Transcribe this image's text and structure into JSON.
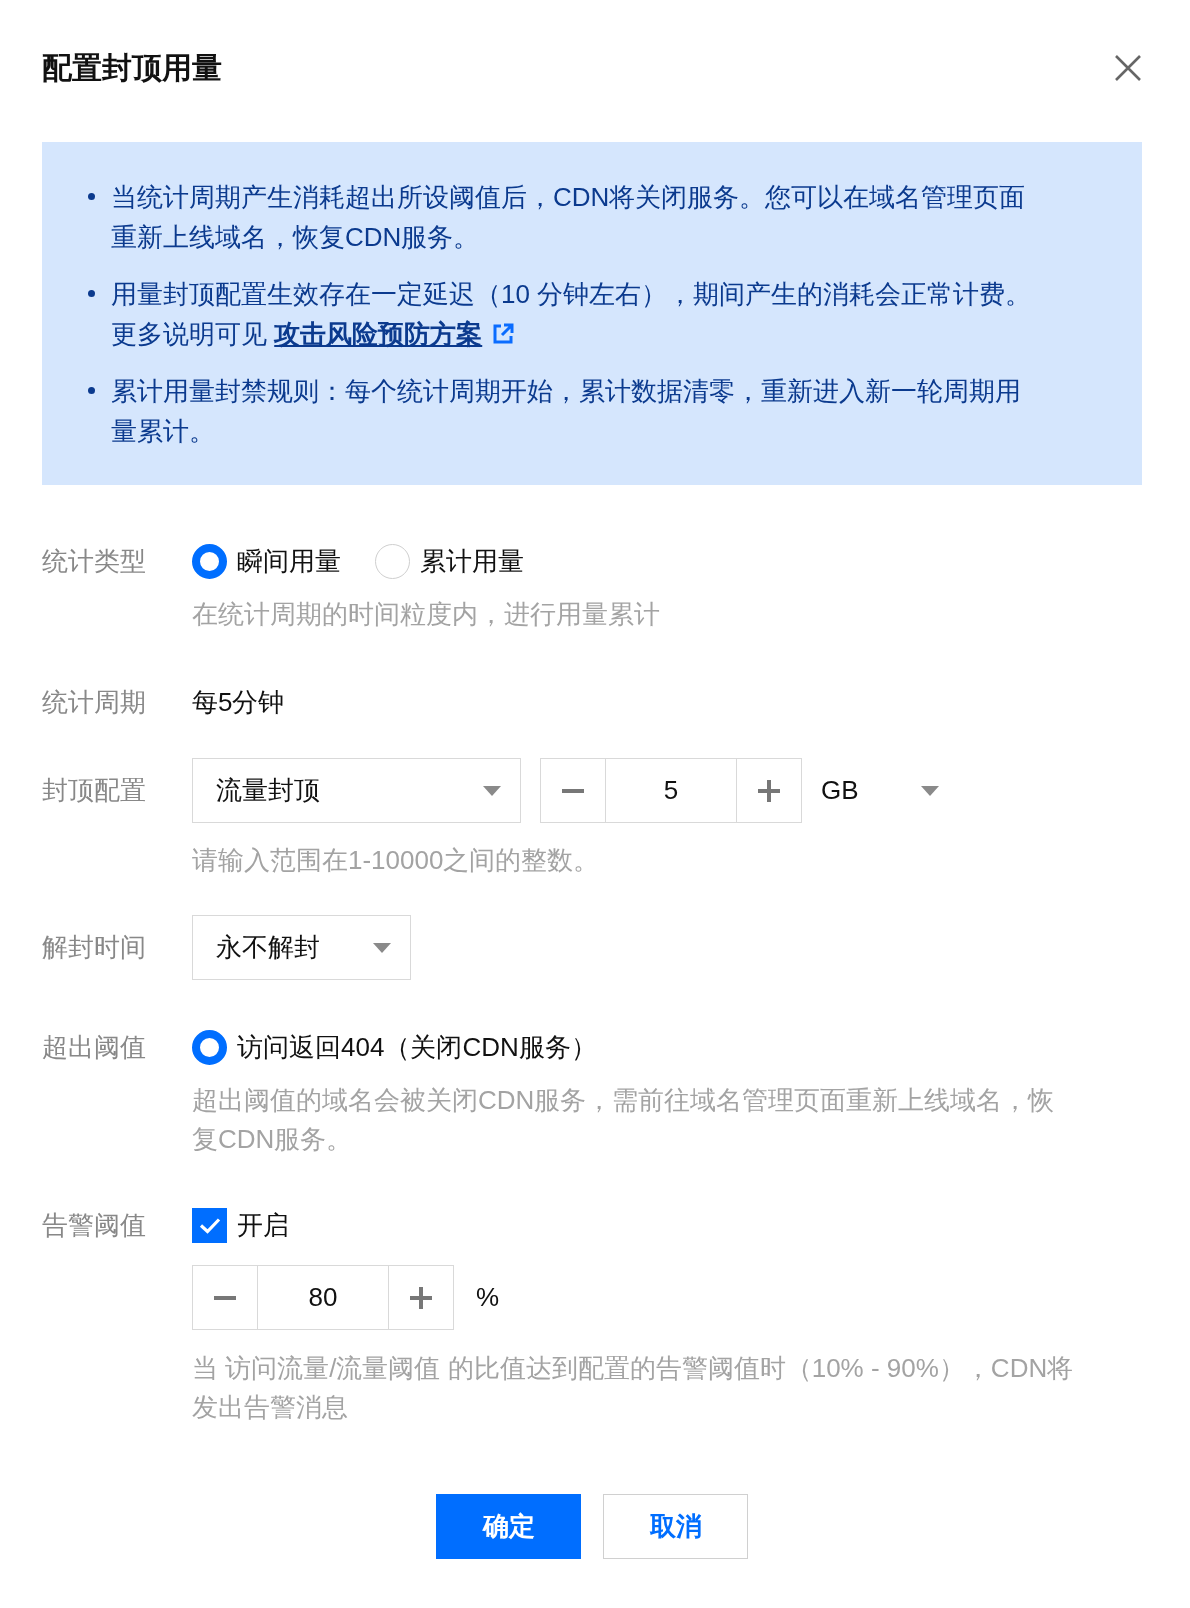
{
  "dialog": {
    "title": "配置封顶用量"
  },
  "notice": {
    "items": [
      {
        "text": "当统计周期产生消耗超出所设阈值后，CDN将关闭服务。您可以在域名管理页面重新上线域名，恢复CDN服务。"
      },
      {
        "text": "用量封顶配置生效存在一定延迟（10 分钟左右），期间产生的消耗会正常计费。",
        "more": "更多说明可见",
        "link": "攻击风险预防方案"
      },
      {
        "text": "累计用量封禁规则：每个统计周期开始，累计数据清零，重新进入新一轮周期用量累计。"
      }
    ]
  },
  "form": {
    "fields": [
      {
        "kind": "radio",
        "label": "统计类型",
        "options": [
          {
            "label": "瞬间用量",
            "selected": true
          },
          {
            "label": "累计用量",
            "selected": false
          }
        ],
        "hint": "在统计周期的时间粒度内，进行用量累计"
      },
      {
        "kind": "text",
        "label": "统计周期",
        "value": "每5分钟"
      },
      {
        "kind": "quota",
        "label": "封顶配置",
        "select": {
          "value": "流量封顶"
        },
        "stepper": {
          "value": "5"
        },
        "unit": {
          "value": "GB"
        },
        "hint": "请输入范围在1-10000之间的整数。"
      },
      {
        "kind": "select",
        "label": "解封时间",
        "select": {
          "value": "永不解封"
        }
      },
      {
        "kind": "radio",
        "label": "超出阈值",
        "options": [
          {
            "label": "访问返回404（关闭CDN服务）",
            "selected": true
          }
        ],
        "hint": "超出阈值的域名会被关闭CDN服务，需前往域名管理页面重新上线域名，恢复CDN服务。"
      },
      {
        "kind": "alert",
        "label": "告警阈值",
        "checkbox": {
          "label": "开启",
          "checked": true
        },
        "stepper": {
          "value": "80"
        },
        "unit": "%",
        "hint": "当 访问流量/流量阈值 的比值达到配置的告警阈值时（10% - 90%），CDN将发出告警消息"
      }
    ]
  },
  "buttons": [
    {
      "label": "确定",
      "kind": "primary"
    },
    {
      "label": "取消",
      "kind": "secondary"
    }
  ]
}
